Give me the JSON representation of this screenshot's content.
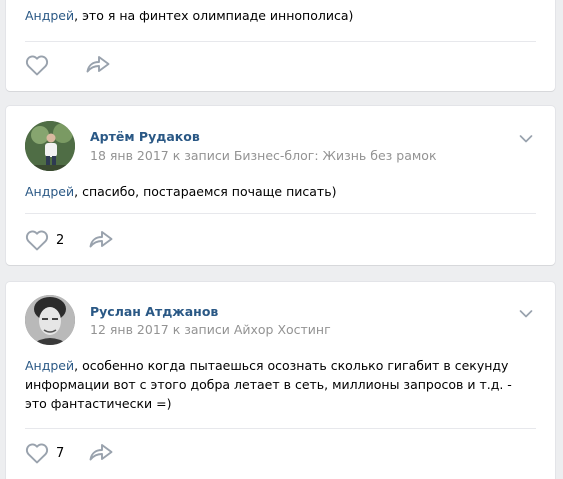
{
  "posts": [
    {
      "mention": "Андрей",
      "text": ", это я на финтех олимпиаде иннополиса)",
      "likes": ""
    },
    {
      "author": "Артём Рудаков",
      "date": "18 янв 2017",
      "to_prefix": " к записи ",
      "target": "Бизнес-блог: Жизнь без рамок",
      "mention": "Андрей",
      "text": ", спасибо, постараемся почаще писать)",
      "likes": "2"
    },
    {
      "author": "Руслан Атджанов",
      "date": "12 янв 2017",
      "to_prefix": " к записи ",
      "target": "Айхор Хостинг",
      "mention": "Андрей",
      "text": ", особенно когда пытаешься осознать сколько гигабит в секунду информации вот с этого добра летает в сеть, миллионы запросов и т.д. - это фантастически =)",
      "likes": "7"
    }
  ],
  "colors": {
    "link": "#2a5885",
    "meta": "#939393",
    "icon": "#99a2ad",
    "background": "#edeef0"
  },
  "icons": [
    "heart-icon",
    "share-arrow-icon",
    "chevron-down-icon"
  ]
}
